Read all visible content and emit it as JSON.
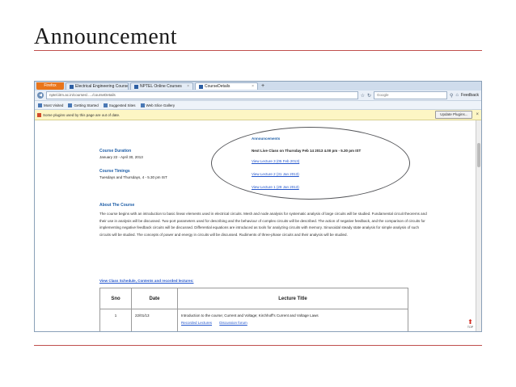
{
  "slide": {
    "title": "Announcement"
  },
  "browser": {
    "menu_button": "Firefox",
    "tabs": [
      {
        "label": "Electrical Engineering Courses in Engi..."
      },
      {
        "label": "NPTEL Online Courses"
      },
      {
        "label": "CourseDetails"
      }
    ],
    "new_tab": "+",
    "url": "nptel.iitm.ac.in/courses/...../courseDetails",
    "search_placeholder": "Google",
    "feedback_label": "Feedback",
    "bookmarks": [
      "Most Visited",
      "Getting Started",
      "Suggested Sites",
      "Web Slice Gallery"
    ],
    "plugin_message": "Some plugins used by this page are out of date.",
    "update_button": "Update Plugins..."
  },
  "course": {
    "duration_heading": "Course Duration",
    "duration_value": "January 22 - April 30, 2013",
    "timings_heading": "Course Timings",
    "timings_value": "Tuesdays and Thursdays, 4 - 5.30 pm IST",
    "announcements_heading": "Announcements",
    "next_class": "Next Live Class on Thursday Feb 14 2013 4.00 pm - 5.30 pm IST",
    "lectures": [
      "View Lecture 3 (05 Feb 2013)",
      "View Lecture 2 (31 Jan 2013)",
      "View Lecture 1 (29 Jan 2013)"
    ],
    "about_heading": "About The Course",
    "about_text": "The course begins with an introduction to basic linear elements used in electrical circuits. Mesh and node analysis for systematic analysis of large circuits will be studied. Fundamental circuit theorems and their use in analysis will be discussed. Two-port parameters used for describing and the behaviour of complex circuits will be described. The action of negative feedback, and the comparison of circuits for implementing negative feedback circuits will be discussed. Differential equations are introduced as tools for analyzing circuits with memory. Sinusoidal steady state analysis for simple analysis of such circuits will be studied. The concepts of power and energy in circuits will be discussed. Rudiments of three-phase circuits and their analysis will be studied.",
    "schedule_link": "View Class Schedule, Contents and recorded lectures:",
    "table": {
      "headers": [
        "Sno",
        "Date",
        "Lecture Title"
      ],
      "rows": [
        {
          "sno": "1",
          "date": "22/01/13",
          "title": "Introduction to the course; Current and Voltage; Kirchhoff's Current and Voltage Laws",
          "links": [
            "Recorded Lectures",
            "Discussion forum"
          ]
        },
        {
          "sno": "",
          "date": "",
          "title": "",
          "links": []
        }
      ]
    },
    "up_label": "TOP"
  },
  "colors": {
    "accent_rule": "#c0504d",
    "heading_blue": "#1f5fa8",
    "link_blue": "#2255cc",
    "firefox_orange": "#e9751b"
  }
}
